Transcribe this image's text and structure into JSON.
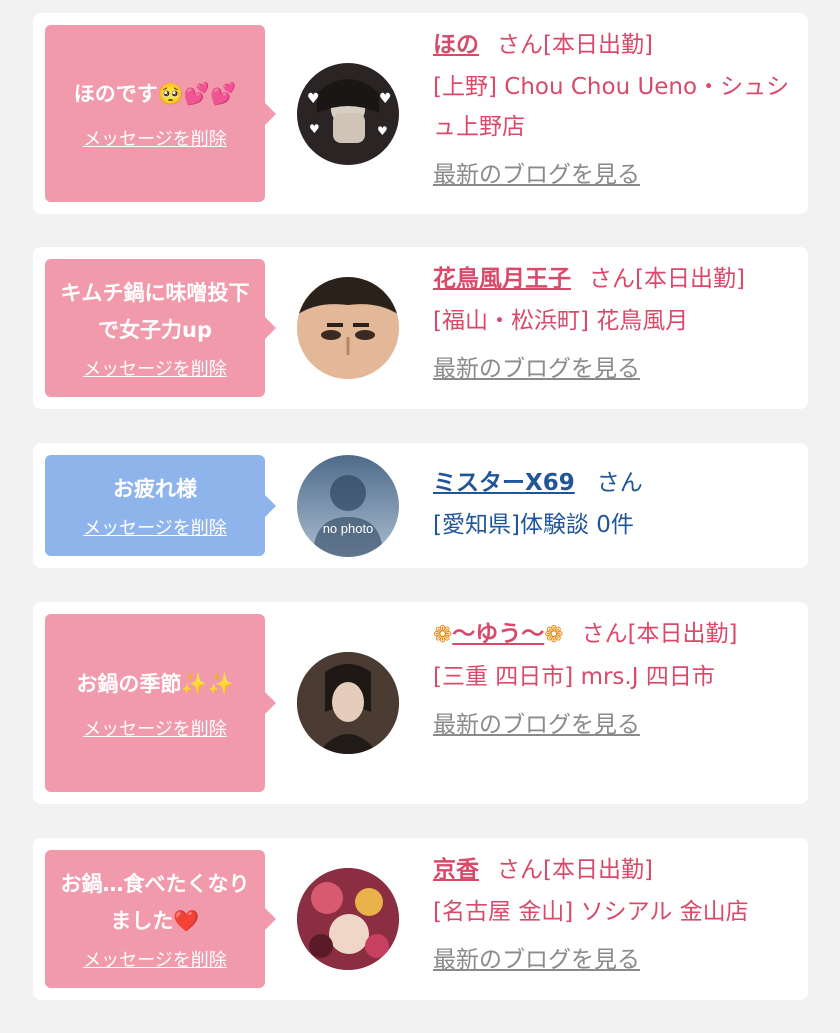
{
  "cards": [
    {
      "message": "ほのです🥺💕💕",
      "delete_label": "メッセージを削除",
      "name": "ほの",
      "suffix": "さん[本日出勤]",
      "shop": "[上野] Chou Chou Ueno・シュシュ上野店",
      "blog_label": "最新のブログを見る"
    },
    {
      "message": "キムチ鍋に味噌投下で女子力up",
      "delete_label": "メッセージを削除",
      "name": "花鳥風月王子",
      "suffix": "さん[本日出勤]",
      "shop": "[福山・松浜町] 花鳥風月",
      "blog_label": "最新のブログを見る"
    },
    {
      "message": "お疲れ様",
      "delete_label": "メッセージを削除",
      "name": "ミスターX69",
      "suffix": "さん",
      "shop": "[愛知県]体験談 0件",
      "avatar_text": "no photo"
    },
    {
      "message": "お鍋の季節✨✨",
      "delete_label": "メッセージを削除",
      "name": "〜ゆう〜",
      "suffix": "さん[本日出勤]",
      "shop": "[三重 四日市] mrs.J 四日市",
      "blog_label": "最新のブログを見る"
    },
    {
      "message": "お鍋…食べたくなりました❤️",
      "delete_label": "メッセージを削除",
      "name": "京香",
      "suffix": "さん[本日出勤]",
      "shop": "[名古屋 金山] ソシアル 金山店",
      "blog_label": "最新のブログを見る"
    }
  ],
  "colors": {
    "pink_bubble": "#f09aab",
    "blue_bubble": "#8fb4ec",
    "pink_text": "#d94a6a",
    "blue_text": "#1f5599"
  }
}
